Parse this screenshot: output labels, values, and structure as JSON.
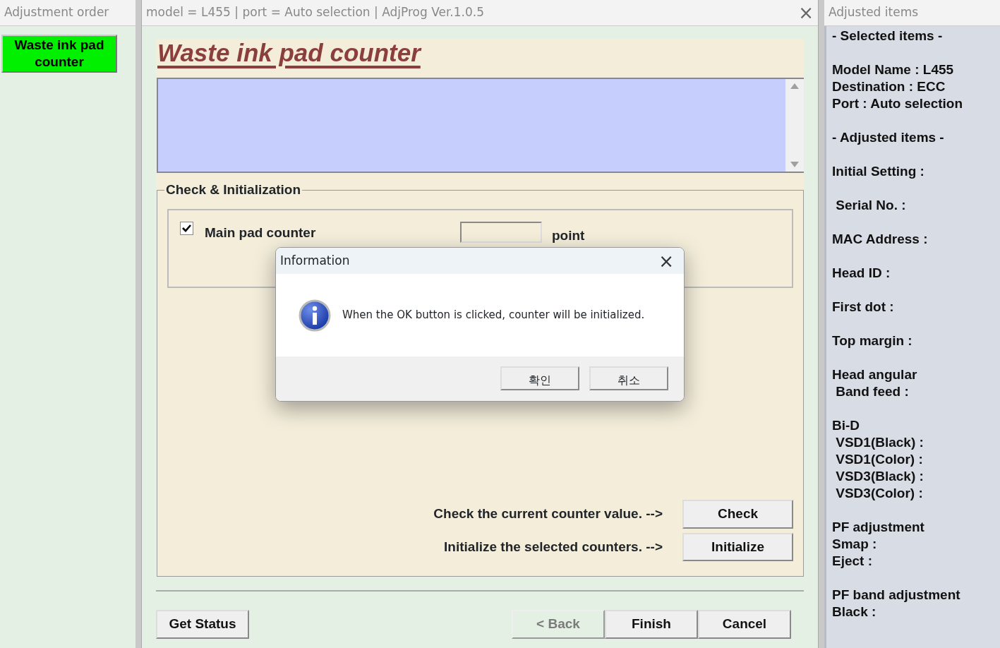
{
  "left_panel": {
    "title": "Adjustment order",
    "items": [
      {
        "label": "Waste ink pad counter",
        "selected": true
      }
    ]
  },
  "main_window": {
    "title": "model = L455 | port = Auto selection | AdjProg Ver.1.0.5",
    "close": "×",
    "heading": "Waste ink pad counter",
    "group": {
      "title": "Check & Initialization",
      "counters": [
        {
          "label": "Main pad counter",
          "checked": true,
          "unit": "point"
        }
      ],
      "actions": [
        {
          "text": "Check the current counter value. -->",
          "button": "Check"
        },
        {
          "text": "Initialize the selected counters. -->",
          "button": "Initialize"
        }
      ]
    },
    "left_buttons": [
      {
        "label": "Get Status",
        "disabled": false
      }
    ],
    "right_buttons": [
      {
        "label": "< Back",
        "disabled": true
      },
      {
        "label": "Finish",
        "disabled": false
      },
      {
        "label": "Cancel",
        "disabled": false
      }
    ]
  },
  "right_panel": {
    "title": "Adjusted items",
    "groups": [
      [
        "- Selected items -"
      ],
      [
        "Model Name : L455",
        "Destination : ECC",
        "Port : Auto selection"
      ],
      [
        "- Adjusted items -"
      ],
      [
        "Initial Setting :"
      ],
      [
        " Serial No. :"
      ],
      [
        "MAC Address :"
      ],
      [
        "Head ID :"
      ],
      [
        "First dot :"
      ],
      [
        "Top margin :"
      ],
      [
        "Head angular",
        " Band feed :"
      ],
      [
        "Bi-D",
        " VSD1(Black) :",
        " VSD1(Color) :",
        " VSD3(Black) :",
        " VSD3(Color) :"
      ],
      [
        "PF adjustment",
        "Smap :",
        "Eject :"
      ],
      [
        "PF band adjustment",
        "Black :"
      ]
    ]
  },
  "dialog": {
    "title": "Information",
    "close": "×",
    "message": "When the OK button is clicked, counter will be initialized.",
    "buttons": [
      "확인",
      "취소"
    ]
  }
}
